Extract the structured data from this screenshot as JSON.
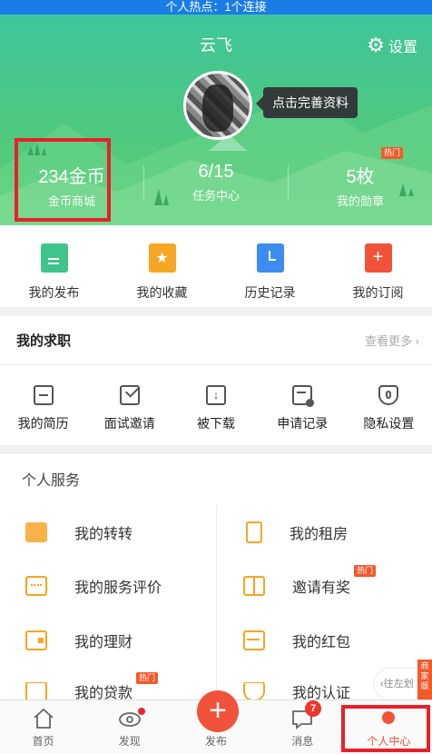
{
  "status_bar": {
    "hotspot_text": "个人热点：1个连接"
  },
  "header": {
    "username": "云飞",
    "settings_label": "设置",
    "profile_tip": "点击完善资料",
    "stats": [
      {
        "value": "234金币",
        "label": "金币商城"
      },
      {
        "value": "6/15",
        "label": "任务中心"
      },
      {
        "value": "5枚",
        "label": "我的勋章",
        "badge": "热门"
      }
    ]
  },
  "quick_actions": [
    {
      "label": "我的发布",
      "icon": "document-icon",
      "color": "#3fc48a"
    },
    {
      "label": "我的收藏",
      "icon": "folder-star-icon",
      "color": "#f5a623"
    },
    {
      "label": "历史记录",
      "icon": "clock-icon",
      "color": "#3d8df0"
    },
    {
      "label": "我的订阅",
      "icon": "add-bookmark-icon",
      "color": "#f0533a"
    }
  ],
  "jobs": {
    "title": "我的求职",
    "more_label": "查看更多 ›",
    "items": [
      {
        "label": "我的简历",
        "icon": "resume-icon"
      },
      {
        "label": "面试邀请",
        "icon": "envelope-icon"
      },
      {
        "label": "被下载",
        "icon": "download-icon"
      },
      {
        "label": "申请记录",
        "icon": "application-record-icon"
      },
      {
        "label": "隐私设置",
        "icon": "privacy-shield-icon"
      }
    ]
  },
  "services": {
    "title": "个人服务",
    "items": [
      {
        "label": "我的转转",
        "icon": "zhuanzhuan-icon"
      },
      {
        "label": "我的租房",
        "icon": "building-icon"
      },
      {
        "label": "我的服务评价",
        "icon": "calendar-rating-icon"
      },
      {
        "label": "邀请有奖",
        "icon": "gift-icon",
        "badge": "热门"
      },
      {
        "label": "我的理财",
        "icon": "wallet-icon"
      },
      {
        "label": "我的红包",
        "icon": "red-envelope-icon"
      },
      {
        "label": "我的贷款",
        "icon": "loan-icon",
        "badge": "热门"
      },
      {
        "label": "我的认证",
        "icon": "shield-check-icon"
      }
    ]
  },
  "floating": {
    "side_tab": "商家版",
    "left_tab": "‹往左划"
  },
  "tabbar": {
    "tabs": [
      {
        "label": "首页",
        "icon": "home-icon"
      },
      {
        "label": "发现",
        "icon": "eye-icon"
      },
      {
        "label": "发布",
        "icon": "plus-icon"
      },
      {
        "label": "消息",
        "icon": "message-icon",
        "badge": "7"
      },
      {
        "label": "个人中心",
        "icon": "profile-icon"
      }
    ],
    "publish_symbol": "+"
  },
  "colors": {
    "header_green": "#4fc97d",
    "accent_red": "#e8202a",
    "orange": "#f5a623"
  }
}
